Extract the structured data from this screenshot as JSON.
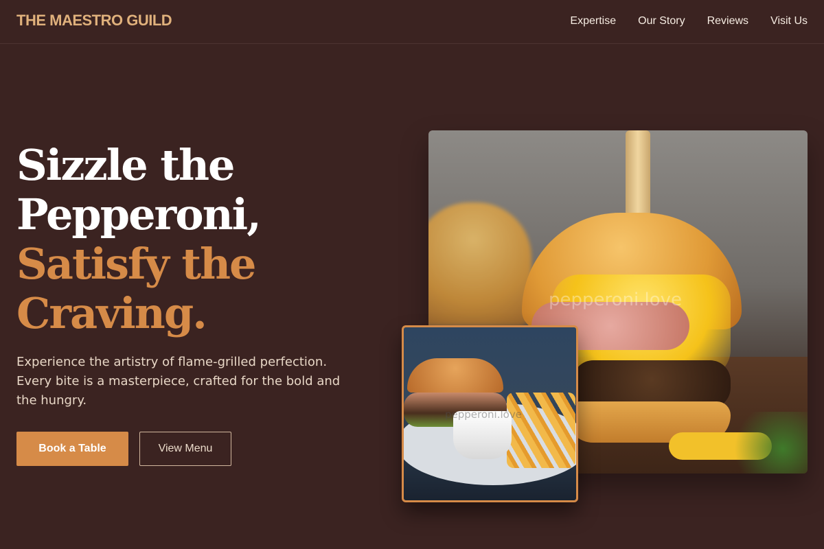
{
  "header": {
    "brand": "THE MAESTRO GUILD",
    "nav": [
      {
        "label": "Expertise"
      },
      {
        "label": "Our Story"
      },
      {
        "label": "Reviews"
      },
      {
        "label": "Visit Us"
      }
    ]
  },
  "hero": {
    "title_lines": [
      "Sizzle the",
      "Pepperoni,"
    ],
    "accent_lines": [
      "Satisfy the",
      "Craving."
    ],
    "description": "Experience the artistry of flame-grilled perfection. Every bite is a masterpiece, crafted for the bold and the hungry.",
    "primary_button": "Book a Table",
    "secondary_button": "View Menu"
  },
  "images": {
    "main_watermark": "pepperoni.love",
    "inset_watermark": "pepperoni.love"
  },
  "colors": {
    "background": "#3b2321",
    "accent": "#d68b48",
    "brand": "#e0b17c",
    "text": "#ffffff"
  }
}
